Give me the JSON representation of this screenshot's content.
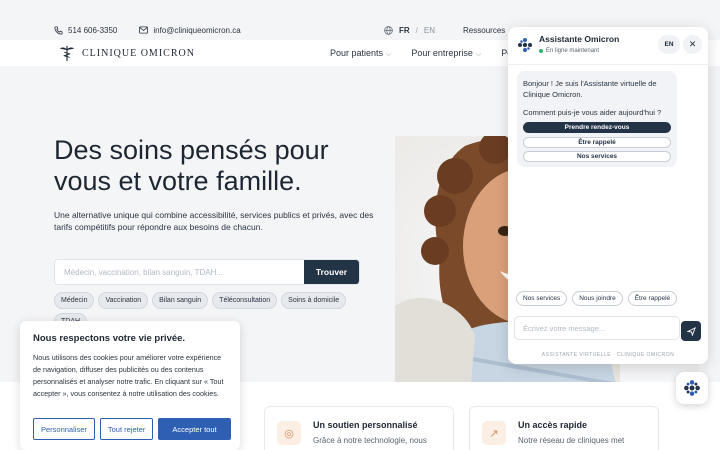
{
  "topbar": {
    "phone": "514 606-3350",
    "email": "info@cliniqueomicron.ca",
    "lang_active": "FR",
    "lang_sep": "/",
    "lang_inactive": "EN",
    "resources": "Ressources",
    "sep": "|"
  },
  "logo": {
    "text": "Clinique Omicron"
  },
  "nav": {
    "patients": "Pour patients",
    "entreprise": "Pour entreprise",
    "portal": "Porta"
  },
  "hero": {
    "title": "Des soins pensés pour vous et votre famille.",
    "subtitle": "Une alternative unique qui combine accessibilité, services publics et privés, avec des tarifs compétitifs pour répondre aux besoins de chacun.",
    "search_placeholder": "Médecin, vaccination, bilan sanguin, TDAH...",
    "search_button": "Trouver",
    "chips": [
      "Médecin",
      "Vaccination",
      "Bilan sanguin",
      "Téléconsultation",
      "Soins à domicile",
      "TDAH"
    ]
  },
  "cookie": {
    "title": "Nous respectons votre vie privée.",
    "body": "Nous utilisons des cookies pour améliorer votre expérience de navigation, diffuser des publicités ou des contenus personnalisés et analyser notre trafic. En cliquant sur « Tout accepter », vous consentez à notre utilisation des cookies.",
    "customize": "Personnaliser",
    "reject": "Tout rejeter",
    "accept": "Accepter tout"
  },
  "cards": [
    {
      "title": "Un soutien personnalisé",
      "desc": "Grâce à notre technologie, nous"
    },
    {
      "title": "Un accès rapide",
      "desc": "Notre réseau de cliniques met"
    }
  ],
  "chat": {
    "name": "Assistante Omicron",
    "status": "En ligne maintenant",
    "lang": "EN",
    "greeting": "Bonjour ! Je suis l'Assistante virtuelle de Clinique Omicron.",
    "question": "Comment puis-je vous aider aujourd'hui ?",
    "option_primary": "Prendre rendez-vous",
    "option_2": "Être rappelé",
    "option_3": "Nos services",
    "quick": [
      "Nos services",
      "Nous joindre",
      "Être rappelé"
    ],
    "input_placeholder": "Écrivez votre message...",
    "footer": "ASSISTANTE VIRTUELLE · CLINIQUE OMICRON"
  },
  "colors": {
    "navy": "#243447",
    "accent_blue": "#2f5fb3",
    "status_green": "#2fb36b",
    "card_icon": "#e0895a"
  }
}
